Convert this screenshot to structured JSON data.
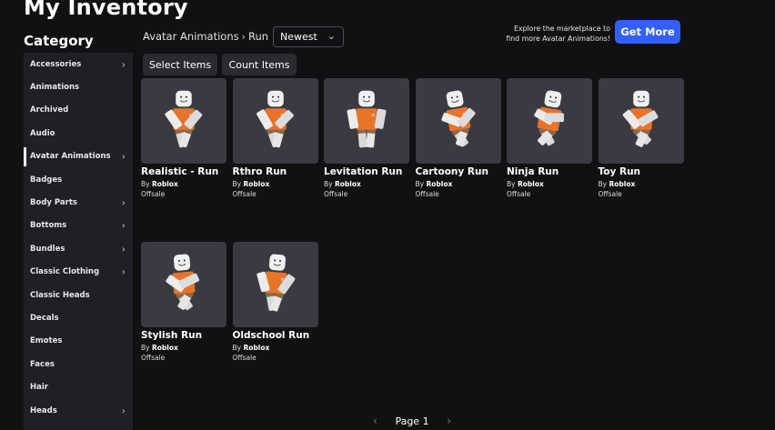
{
  "page": {
    "title": "My Inventory"
  },
  "sidebar": {
    "title": "Category",
    "items": [
      {
        "label": "Accessories",
        "chevron": true,
        "active": false
      },
      {
        "label": "Animations",
        "chevron": false,
        "active": false
      },
      {
        "label": "Archived",
        "chevron": false,
        "active": false
      },
      {
        "label": "Audio",
        "chevron": false,
        "active": false
      },
      {
        "label": "Avatar Animations",
        "chevron": true,
        "active": true
      },
      {
        "label": "Badges",
        "chevron": false,
        "active": false
      },
      {
        "label": "Body Parts",
        "chevron": true,
        "active": false
      },
      {
        "label": "Bottoms",
        "chevron": true,
        "active": false
      },
      {
        "label": "Bundles",
        "chevron": true,
        "active": false
      },
      {
        "label": "Classic Clothing",
        "chevron": true,
        "active": false
      },
      {
        "label": "Classic Heads",
        "chevron": false,
        "active": false
      },
      {
        "label": "Decals",
        "chevron": false,
        "active": false
      },
      {
        "label": "Emotes",
        "chevron": false,
        "active": false
      },
      {
        "label": "Faces",
        "chevron": false,
        "active": false
      },
      {
        "label": "Hair",
        "chevron": false,
        "active": false
      },
      {
        "label": "Heads",
        "chevron": true,
        "active": false
      }
    ]
  },
  "breadcrumb": {
    "parent": "Avatar Animations",
    "separator": "›",
    "current": "Run"
  },
  "sort": {
    "selected": "Newest",
    "chevron": "⌄"
  },
  "toolbar": {
    "select_label": "Select Items",
    "count_label": "Count Items"
  },
  "promo": {
    "line1": "Explore the marketplace to",
    "line2": "find more Avatar Animations!",
    "button": "Get More"
  },
  "items": [
    {
      "name": "Realistic - Run",
      "by_prefix": "By",
      "creator": "Roblox",
      "status": "Offsale"
    },
    {
      "name": "Rthro Run",
      "by_prefix": "By",
      "creator": "Roblox",
      "status": "Offsale"
    },
    {
      "name": "Levitation Run",
      "by_prefix": "By",
      "creator": "Roblox",
      "status": "Offsale"
    },
    {
      "name": "Cartoony Run",
      "by_prefix": "By",
      "creator": "Roblox",
      "status": "Offsale"
    },
    {
      "name": "Ninja Run",
      "by_prefix": "By",
      "creator": "Roblox",
      "status": "Offsale"
    },
    {
      "name": "Toy Run",
      "by_prefix": "By",
      "creator": "Roblox",
      "status": "Offsale"
    },
    {
      "name": "Stylish Run",
      "by_prefix": "By",
      "creator": "Roblox",
      "status": "Offsale"
    },
    {
      "name": "Oldschool Run",
      "by_prefix": "By",
      "creator": "Roblox",
      "status": "Offsale"
    }
  ],
  "pager": {
    "label": "Page 1",
    "prev": "‹",
    "next": "›"
  },
  "colors": {
    "accent": "#335fff",
    "background": "#111113",
    "sidebar": "#1f2025",
    "thumb": "#3a3b42",
    "shirt": "#e8742a"
  }
}
